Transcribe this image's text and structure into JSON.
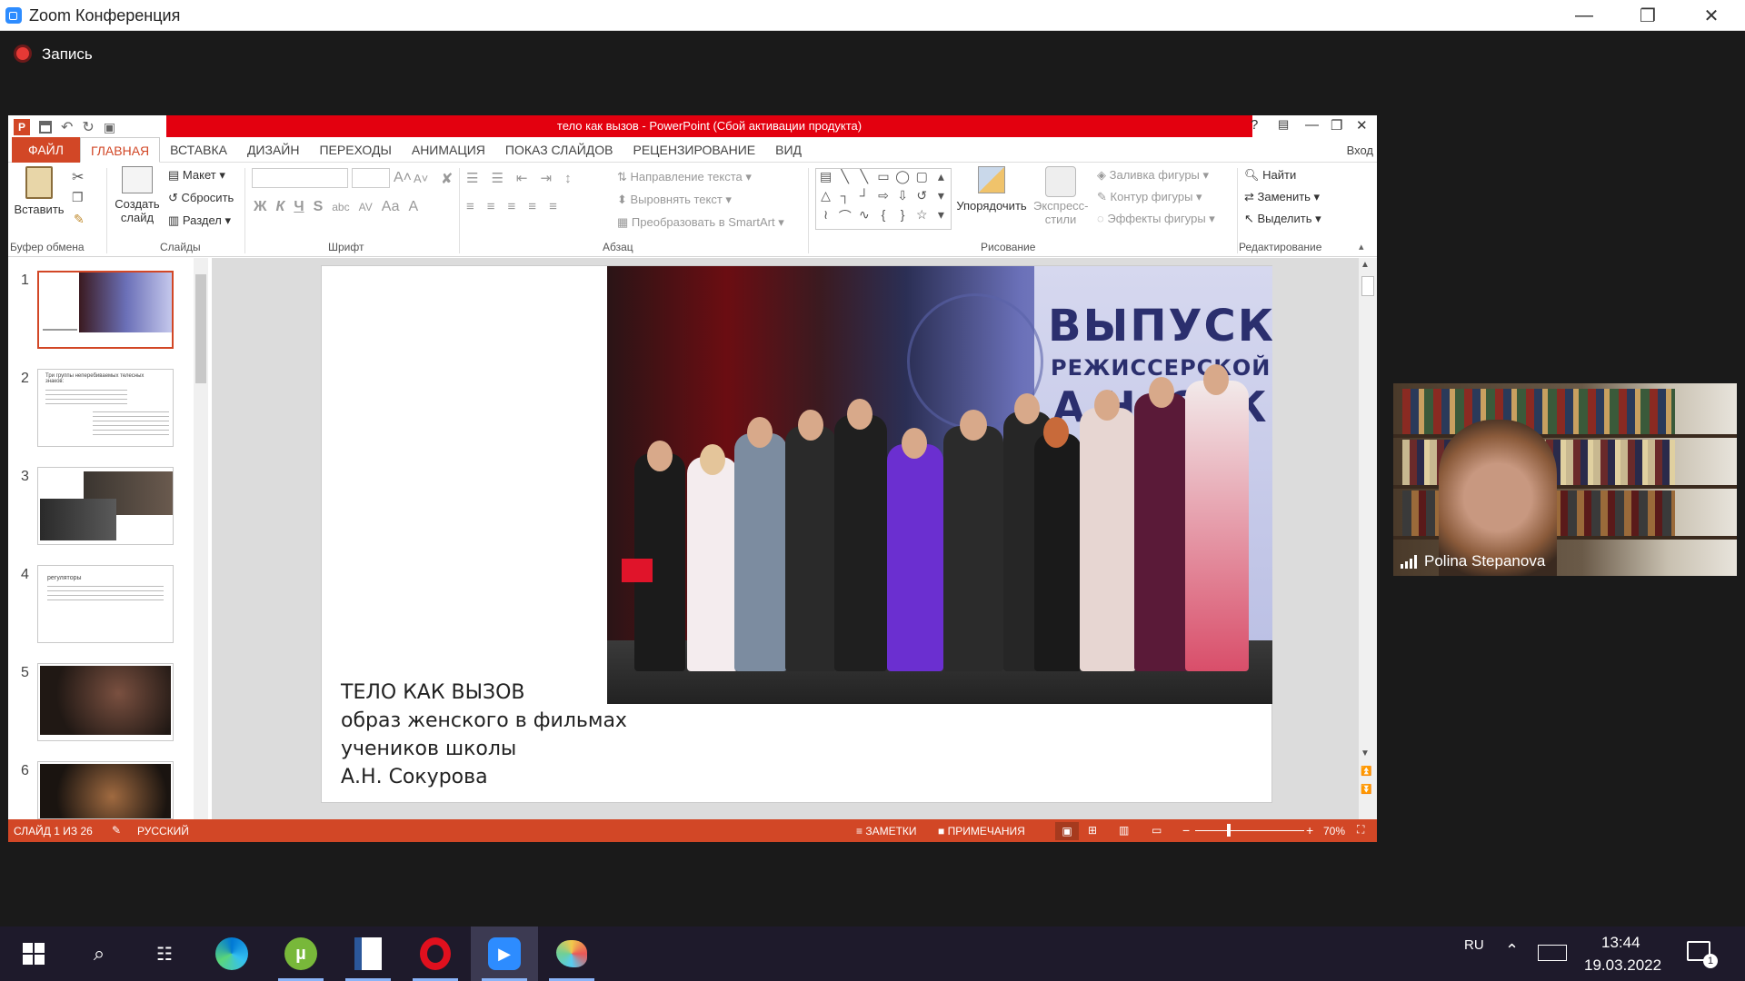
{
  "zoom": {
    "title": "Zoom Конференция",
    "recording_label": "Запись",
    "participant_name": "Polina Stepanova"
  },
  "ppt": {
    "title": "тело как вызов  -  PowerPoint (Сбой активации продукта)",
    "help": "?",
    "signin": "Вход",
    "tabs": [
      "ФАЙЛ",
      "ГЛАВНАЯ",
      "ВСТАВКА",
      "ДИЗАЙН",
      "ПЕРЕХОДЫ",
      "АНИМАЦИЯ",
      "ПОКАЗ СЛАЙДОВ",
      "РЕЦЕНЗИРОВАНИЕ",
      "ВИД"
    ],
    "ribbon": {
      "paste": "Вставить",
      "new_slide_1": "Создать",
      "new_slide_2": "слайд",
      "layout": "Макет",
      "reset": "Сбросить",
      "section": "Раздел",
      "text_direction": "Направление текста",
      "align_text": "Выровнять текст",
      "smartart": "Преобразовать в SmartArt",
      "arrange": "Упорядочить",
      "quick_styles_1": "Экспресс-",
      "quick_styles_2": "стили",
      "shape_fill": "Заливка фигуры",
      "shape_outline": "Контур фигуры",
      "shape_effects": "Эффекты фигуры",
      "find": "Найти",
      "replace": "Заменить",
      "select": "Выделить",
      "font_bold": "Ж",
      "font_italic": "К",
      "font_underline": "Ч",
      "font_strike": "S",
      "font_abc": "abc",
      "font_av": "AV",
      "font_aa": "Аа",
      "font_a": "A",
      "groups": [
        "Буфер обмена",
        "Слайды",
        "Шрифт",
        "Абзац",
        "Рисование",
        "Редактирование"
      ]
    },
    "thumbnails": [
      {
        "num": "1",
        "text": ""
      },
      {
        "num": "2",
        "text": "Три группы неперебиваемых телесных знаков:"
      },
      {
        "num": "3",
        "text": ""
      },
      {
        "num": "4",
        "text": "регуляторы"
      },
      {
        "num": "5",
        "text": ""
      },
      {
        "num": "6",
        "text": ""
      }
    ],
    "slide": {
      "line1": "ТЕЛО КАК ВЫЗОВ",
      "line2": "образ женского в фильмах",
      "line3": "учеников школы",
      "line4": "А.Н. Сокурова",
      "banner1": "ВЫПУСК",
      "banner2": "РЕЖИССЕРСКОЙ",
      "banner3": "А.Н. СОК"
    },
    "status": {
      "slide_info": "СЛАЙД 1 ИЗ 26",
      "language": "РУССКИЙ",
      "notes": "ЗАМЕТКИ",
      "comments": "ПРИМЕЧАНИЯ",
      "zoom": "70%"
    }
  },
  "taskbar": {
    "lang": "RU",
    "time": "13:44",
    "date": "19.03.2022",
    "notif_count": "1"
  }
}
